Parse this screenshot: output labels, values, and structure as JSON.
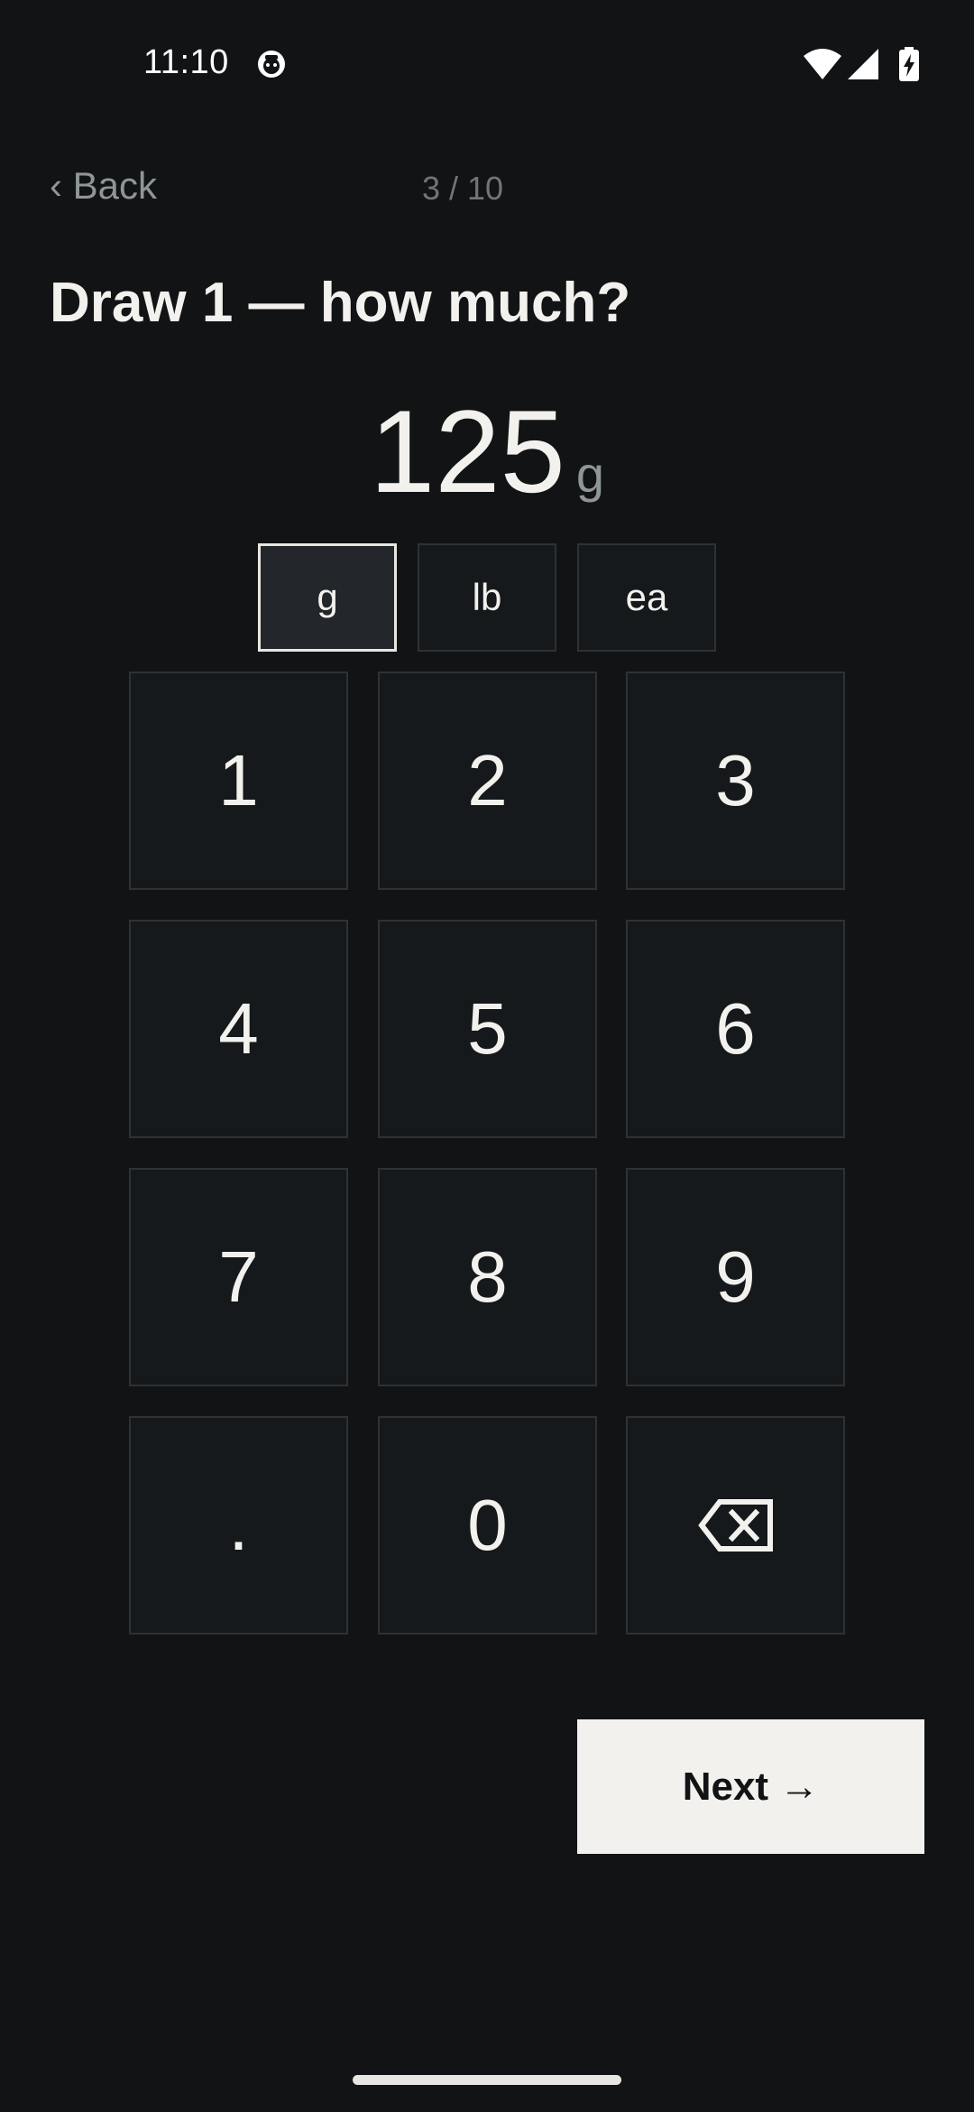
{
  "status_bar": {
    "time": "11:10",
    "icons": [
      "app-notification-icon",
      "wifi-icon",
      "cellular-signal-icon",
      "battery-charging-icon"
    ]
  },
  "nav": {
    "back_label": "‹ Back",
    "progress": "3 / 10"
  },
  "title": "Draw 1 — how much?",
  "amount": {
    "value": "125",
    "unit": "g"
  },
  "units": [
    {
      "label": "g",
      "selected": true
    },
    {
      "label": "lb",
      "selected": false
    },
    {
      "label": "ea",
      "selected": false
    }
  ],
  "keypad": {
    "keys": [
      "1",
      "2",
      "3",
      "4",
      "5",
      "6",
      "7",
      "8",
      "9",
      ".",
      "0"
    ],
    "backspace_icon": "backspace-icon"
  },
  "next_label": "Next →",
  "colors": {
    "background": "#111315",
    "key_background": "#15191c",
    "key_border": "#2e3235",
    "primary_text": "#f2f1ed",
    "muted_text": "#8f9698",
    "next_button_background": "#f2f1ed"
  }
}
